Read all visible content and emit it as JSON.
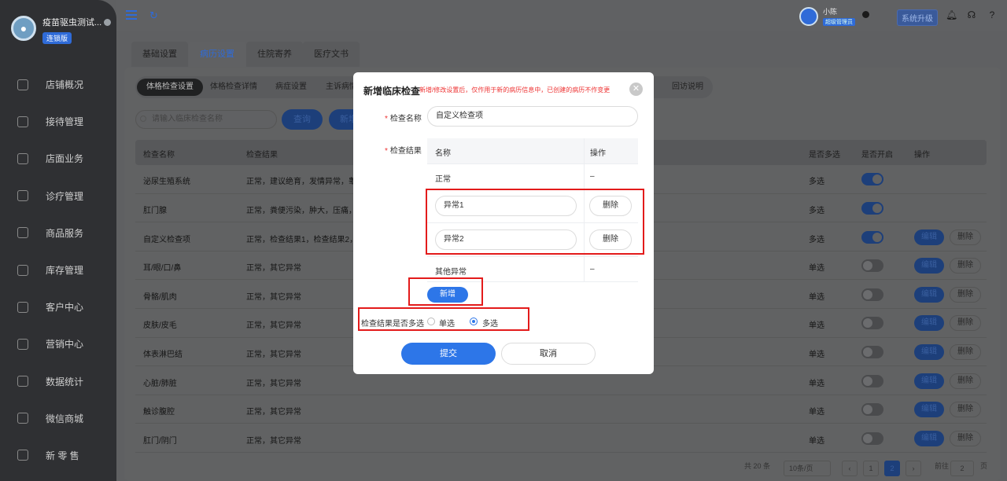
{
  "brand": {
    "name": "疫苗驱虫测试...",
    "badge": "连锁版"
  },
  "nav": [
    "店铺概况",
    "接待管理",
    "店面业务",
    "诊疗管理",
    "商品服务",
    "库存管理",
    "客户中心",
    "营销中心",
    "数据统计",
    "微信商城",
    "新 零 售"
  ],
  "topbar": {
    "user": "小陈",
    "role": "超级管理员",
    "upgrade": "系统升级"
  },
  "top_tabs": [
    "基础设置",
    "病历设置",
    "住院寄养",
    "医疗文书"
  ],
  "sub_tabs": [
    "体格检查设置",
    "体格检查详情",
    "病症设置",
    "主诉病情"
  ],
  "sub_tab_extra": "回访说明",
  "search": {
    "placeholder": "请输入临床检查名称",
    "query": "查询",
    "new": "新增"
  },
  "table": {
    "headers": [
      "检查名称",
      "检查结果",
      "是否多选",
      "是否开启",
      "操作"
    ],
    "rows": [
      {
        "name": "泌尿生殖系统",
        "result": "正常，建议绝育，发情异常，睾丸",
        "multi": "多选",
        "on": true,
        "ops": false
      },
      {
        "name": "肛门腺",
        "result": "正常，粪便污染，肿大，压痛，其",
        "multi": "多选",
        "on": true,
        "ops": false
      },
      {
        "name": "自定义检查项",
        "result": "正常，检查结果1，检查结果2，其",
        "multi": "多选",
        "on": true,
        "ops": true
      },
      {
        "name": "耳/眼/口/鼻",
        "result": "正常，其它异常",
        "multi": "单选",
        "on": false,
        "ops": true
      },
      {
        "name": "骨骼/肌肉",
        "result": "正常，其它异常",
        "multi": "单选",
        "on": false,
        "ops": true
      },
      {
        "name": "皮肤/皮毛",
        "result": "正常，其它异常",
        "multi": "单选",
        "on": false,
        "ops": true
      },
      {
        "name": "体表淋巴结",
        "result": "正常，其它异常",
        "multi": "单选",
        "on": false,
        "ops": true
      },
      {
        "name": "心脏/肺脏",
        "result": "正常，其它异常",
        "multi": "单选",
        "on": false,
        "ops": true
      },
      {
        "name": "触诊腹腔",
        "result": "正常，其它异常",
        "multi": "单选",
        "on": false,
        "ops": true
      },
      {
        "name": "肛门/阴门",
        "result": "正常，其它异常",
        "multi": "单选",
        "on": false,
        "ops": true
      }
    ],
    "edit_label": "编辑",
    "delete_label": "删除"
  },
  "pager": {
    "total": "共 20 条",
    "page_size": "10条/页",
    "pages": [
      "1",
      "2"
    ],
    "current": "2",
    "goto_label": "前往",
    "goto_value": "2",
    "goto_unit": "页"
  },
  "modal": {
    "title": "新增临床检查",
    "note": "新增/修改设置后，仅作用于新的病历信息中，已创建的病历不作变更",
    "name_label": "检查名称",
    "name_value": "自定义检查项",
    "result_label": "检查结果",
    "col_name": "名称",
    "col_op": "操作",
    "rows": [
      {
        "name": "正常",
        "op": "–"
      },
      {
        "name": "异常1",
        "op": "删除"
      },
      {
        "name": "异常2",
        "op": "删除"
      },
      {
        "name": "其他异常",
        "op": "–"
      }
    ],
    "add_label": "新增",
    "multi_label": "检查结果是否多选",
    "single_option": "单选",
    "multi_option": "多选",
    "selected": "多选",
    "submit": "提交",
    "cancel": "取消"
  },
  "colors": {
    "accent": "#2d76e8",
    "highlight": "#e31b1b",
    "sidebar": "#2f3033"
  }
}
